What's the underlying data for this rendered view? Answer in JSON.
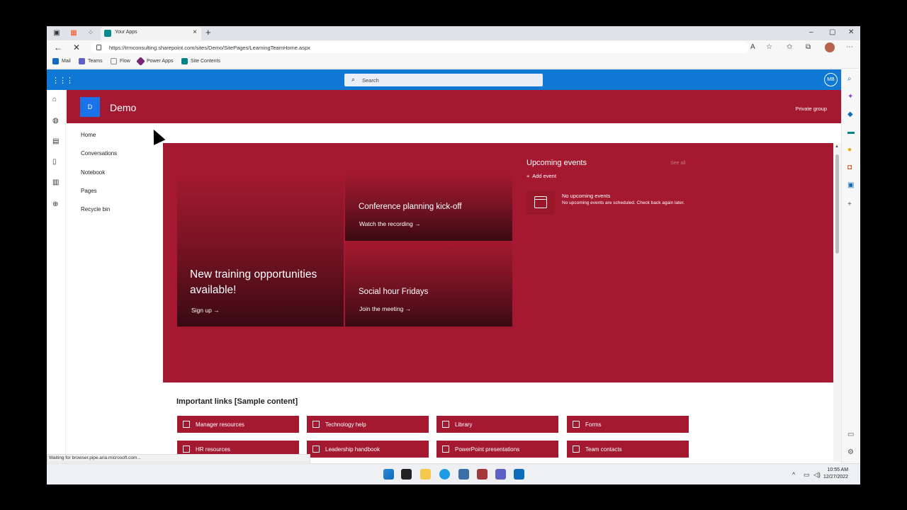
{
  "browser": {
    "tab_title": "Your Apps",
    "url": "https://trmconsulting.sharepoint.com/sites/Demo/SitePages/LearningTeamHome.aspx",
    "favorites": [
      {
        "label": "Mail",
        "color": "#0f6cbd"
      },
      {
        "label": "Teams",
        "color": "#5b5fc7"
      },
      {
        "label": "Flow",
        "color": "#888888"
      },
      {
        "label": "Power Apps",
        "color": "#742774"
      },
      {
        "label": "Site Contents",
        "color": "#038387"
      }
    ],
    "status": "Waiting for browser.pipe.aria.microsoft.com..."
  },
  "suite": {
    "search_placeholder": "Search",
    "user_initials": "MB"
  },
  "site": {
    "logo_letter": "D",
    "title": "Demo",
    "privacy": "Private group"
  },
  "nav": [
    "Home",
    "Conversations",
    "Notebook",
    "Pages",
    "Recycle bin"
  ],
  "hero": {
    "big_title": "New training opportunities available!",
    "big_link": "Sign up",
    "tile1_title": "Conference planning kick-off",
    "tile1_link": "Watch the recording",
    "tile2_title": "Social hour Fridays",
    "tile2_link": "Join the meeting"
  },
  "events": {
    "heading": "Upcoming events",
    "see_all": "See all",
    "add": "Add event",
    "empty_title": "No upcoming events",
    "empty_desc": "No upcoming events are scheduled. Check back again later."
  },
  "links": {
    "heading": "Important links [Sample content]",
    "items": [
      "Manager resources",
      "Technology help",
      "Library",
      "Forms",
      "HR resources",
      "Leadership handbook",
      "PowerPoint presentations",
      "Team contacts"
    ]
  },
  "clock": {
    "time": "10:55 AM",
    "date": "12/27/2022"
  },
  "colors": {
    "accent": "#a4192f",
    "suite": "#0f78d4"
  }
}
